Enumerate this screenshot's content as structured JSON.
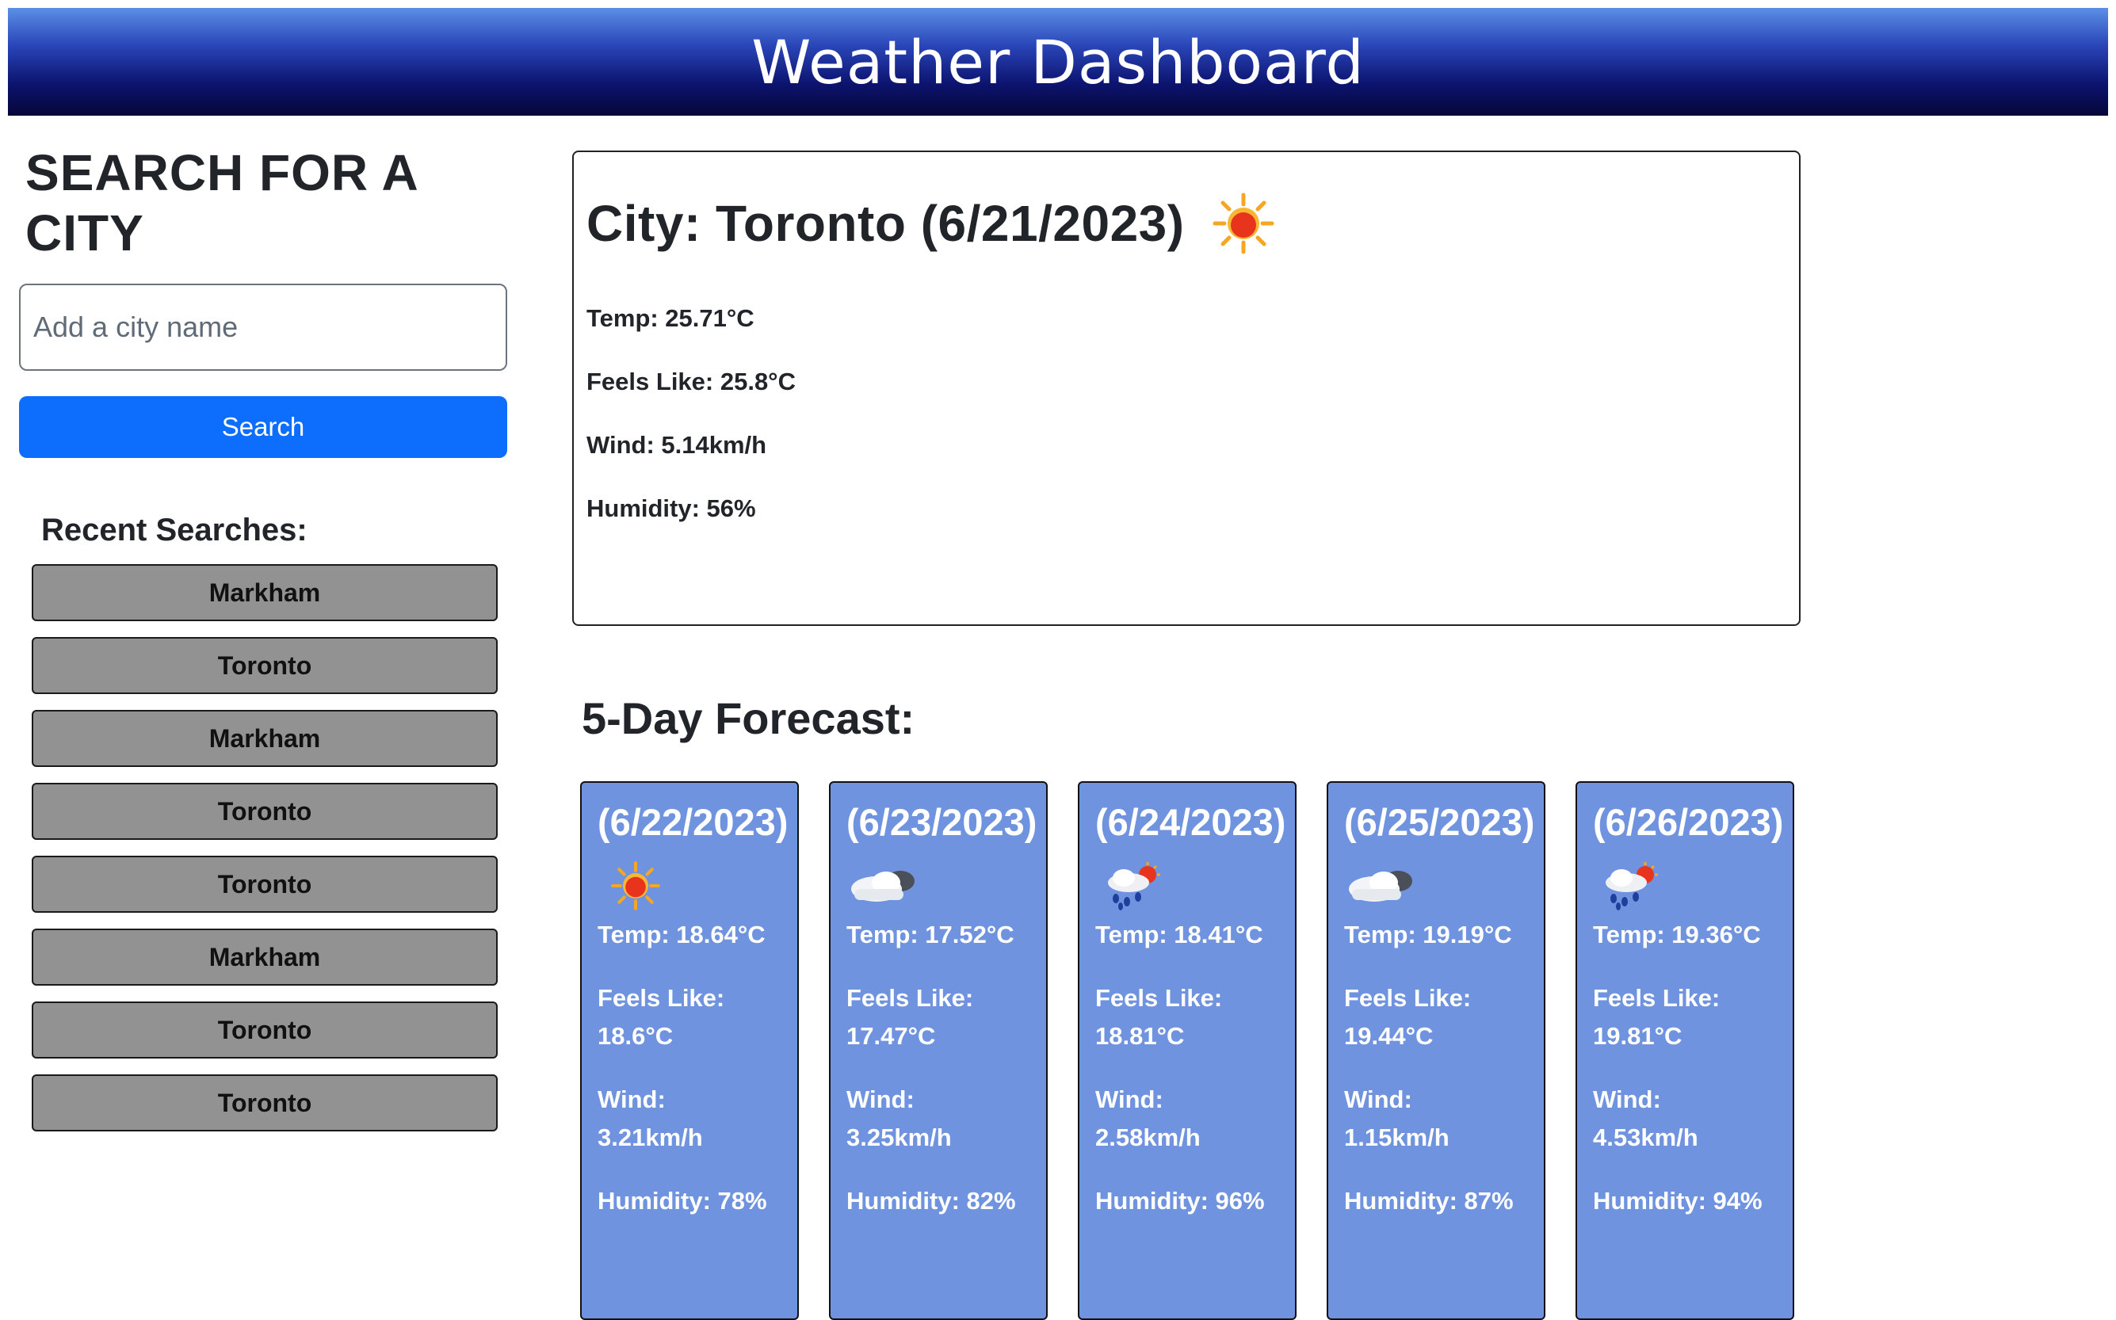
{
  "header": {
    "title": "Weather Dashboard"
  },
  "sidebar": {
    "heading": "SEARCH FOR A CITY",
    "input_placeholder": "Add a city name",
    "search_label": "Search",
    "recent_title": "Recent Searches:",
    "recent": [
      "Markham",
      "Toronto",
      "Markham",
      "Toronto",
      "Toronto",
      "Markham",
      "Toronto",
      "Toronto"
    ]
  },
  "current": {
    "title": "City: Toronto (6/21/2023)",
    "icon": "sun-icon",
    "temp": "Temp: 25.71°C",
    "feels": "Feels Like: 25.8°C",
    "wind": "Wind: 5.14km/h",
    "humidity": "Humidity: 56%"
  },
  "forecast": {
    "title": "5-Day Forecast:",
    "days": [
      {
        "date": "(6/22/2023)",
        "icon": "sun-icon",
        "temp": "Temp: 18.64°C",
        "feels_label": "Feels Like:",
        "feels": "18.6°C",
        "wind_label": "Wind:",
        "wind": "3.21km/h",
        "humidity": "Humidity: 78%"
      },
      {
        "date": "(6/23/2023)",
        "icon": "cloud-icon",
        "temp": "Temp: 17.52°C",
        "feels_label": "Feels Like:",
        "feels": "17.47°C",
        "wind_label": "Wind:",
        "wind": "3.25km/h",
        "humidity": "Humidity: 82%"
      },
      {
        "date": "(6/24/2023)",
        "icon": "rain-sun-icon",
        "temp": "Temp: 18.41°C",
        "feels_label": "Feels Like:",
        "feels": "18.81°C",
        "wind_label": "Wind:",
        "wind": "2.58km/h",
        "humidity": "Humidity: 96%"
      },
      {
        "date": "(6/25/2023)",
        "icon": "cloud-icon",
        "temp": "Temp: 19.19°C",
        "feels_label": "Feels Like:",
        "feels": "19.44°C",
        "wind_label": "Wind:",
        "wind": "1.15km/h",
        "humidity": "Humidity: 87%"
      },
      {
        "date": "(6/26/2023)",
        "icon": "rain-sun-icon",
        "temp": "Temp: 19.36°C",
        "feels_label": "Feels Like:",
        "feels": "19.81°C",
        "wind_label": "Wind:",
        "wind": "4.53km/h",
        "humidity": "Humidity: 94%"
      }
    ]
  }
}
